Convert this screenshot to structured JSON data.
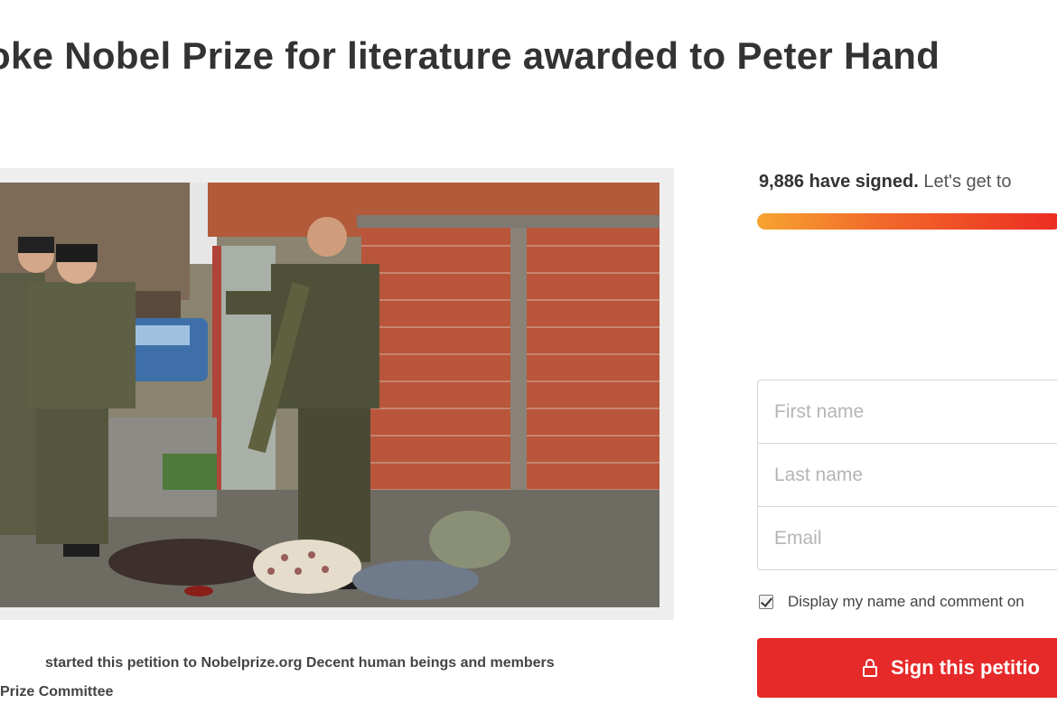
{
  "petition": {
    "title": "oke Nobel Prize for literature awarded to Peter Hand",
    "byline_line1": "started this petition to Nobelprize.org Decent human beings and members",
    "byline_line2": "Prize Committee"
  },
  "signatures": {
    "count_text": "9,886 have signed.",
    "goal_text": " Let's get to",
    "progress_fraction": 0.99
  },
  "form": {
    "first_name_placeholder": "First name",
    "last_name_placeholder": "Last name",
    "email_placeholder": "Email",
    "consent_label": "Display my name and comment on",
    "consent_checked": true,
    "submit_label": "Sign this petitio"
  },
  "colors": {
    "accent": "#e62a29",
    "progress_start": "#f7a431",
    "progress_end": "#ec2c22"
  },
  "icons": {
    "submit": "lock-icon",
    "consent": "checkbox-checked-icon"
  }
}
